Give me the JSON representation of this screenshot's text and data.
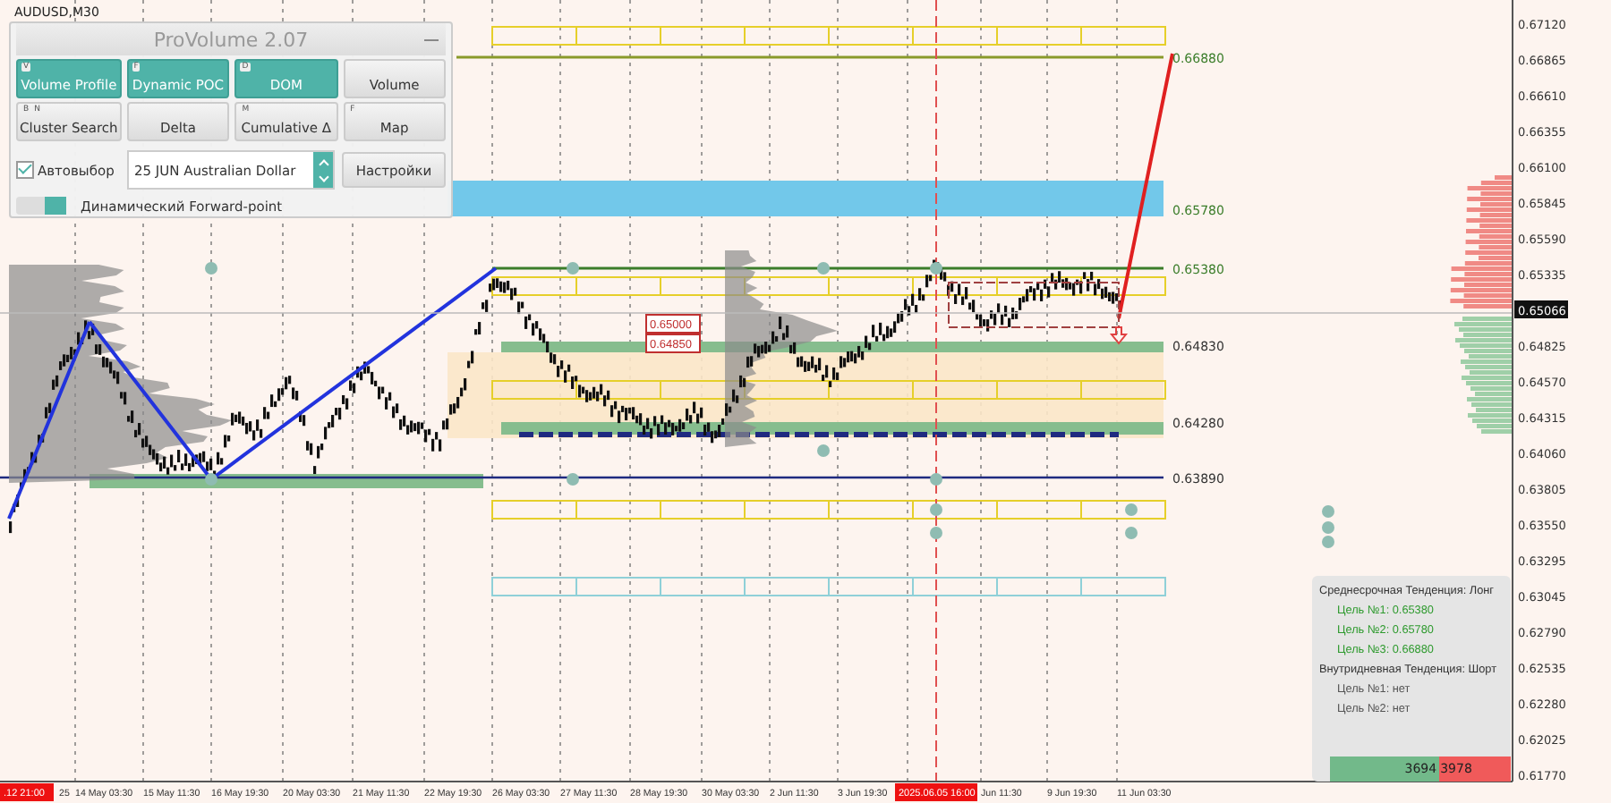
{
  "symbol": "AUDUSD,M30",
  "panel": {
    "title": "ProVolume 2.07",
    "buttons": [
      {
        "label": "Volume Profile",
        "hotkeys": [
          "V"
        ],
        "active": true
      },
      {
        "label": "Dynamic POC",
        "hotkeys": [
          "F"
        ],
        "active": true
      },
      {
        "label": "DOM",
        "hotkeys": [
          "D"
        ],
        "active": true
      },
      {
        "label": "Volume",
        "active": false
      },
      {
        "label": "Cluster Search",
        "hotkeys": [
          "B",
          "N"
        ],
        "active": false
      },
      {
        "label": "Delta",
        "active": false
      },
      {
        "label": "Cumulative Δ",
        "hotkeys": [
          "M"
        ],
        "active": false
      },
      {
        "label": "Map",
        "hotkeys": [
          "F"
        ],
        "active": false
      }
    ],
    "auto_select": {
      "label": "Автовыбор",
      "checked": true
    },
    "instrument": {
      "value": "25 JUN Australian Dollar"
    },
    "settings_button": "Настройки",
    "forward_point": {
      "label": "Динамический Forward-point",
      "on": true
    }
  },
  "level_labels": [
    "0.66880",
    "0.65780",
    "0.65380",
    "0.64830",
    "0.64280",
    "0.63890"
  ],
  "marker_labels": [
    "0.65000",
    "0.64850"
  ],
  "price_axis": {
    "labels": [
      {
        "text": "0.67120",
        "current": false
      },
      {
        "text": "0.66865",
        "current": false
      },
      {
        "text": "0.66610",
        "current": false
      },
      {
        "text": "0.66355",
        "current": false
      },
      {
        "text": "0.66100",
        "current": false
      },
      {
        "text": "0.65845",
        "current": false
      },
      {
        "text": "0.65590",
        "current": false
      },
      {
        "text": "0.65335",
        "current": false
      },
      {
        "text": "0.65066",
        "current": true
      },
      {
        "text": "0.64825",
        "current": false
      },
      {
        "text": "0.64570",
        "current": false
      },
      {
        "text": "0.64315",
        "current": false
      },
      {
        "text": "0.64060",
        "current": false
      },
      {
        "text": "0.63805",
        "current": false
      },
      {
        "text": "0.63550",
        "current": false
      },
      {
        "text": "0.63295",
        "current": false
      },
      {
        "text": "0.63045",
        "current": false
      },
      {
        "text": "0.62790",
        "current": false
      },
      {
        "text": "0.62535",
        "current": false
      },
      {
        "text": "0.62280",
        "current": false
      },
      {
        "text": "0.62025",
        "current": false
      },
      {
        "text": "0.61770",
        "current": false
      }
    ]
  },
  "time_axis": {
    "labels": [
      "25",
      "14 May 03:30",
      "15 May 11:30",
      "16 May 19:30",
      "20 May 03:30",
      "21 May 11:30",
      "22 May 19:30",
      "26 May 03:30",
      "27 May 11:30",
      "28 May 19:30",
      "30 May 03:30",
      "2 Jun 11:30",
      "3 Jun 19:30",
      "Jun 11:30",
      "9 Jun 19:30",
      "11 Jun 03:30"
    ],
    "highlights": [
      ".12 21:00",
      "2025.06.05 16:00"
    ]
  },
  "trend_box": {
    "lines": [
      {
        "text": "Среднесрочная Тенденция: Лонг",
        "kind": "heading"
      },
      {
        "text": "Цель №1: 0.65380",
        "kind": "hit"
      },
      {
        "text": "Цель №2: 0.65780",
        "kind": "hit"
      },
      {
        "text": "Цель №3: 0.66880",
        "kind": "hit"
      },
      {
        "text": "Внутридневная Тенденция: Шорт",
        "kind": "heading"
      },
      {
        "text": "Цель №1: нет",
        "kind": "open"
      },
      {
        "text": "Цель №2: нет",
        "kind": "open"
      }
    ],
    "balance": {
      "buy": "3694",
      "sell": "3978",
      "level": 0.6
    }
  }
}
